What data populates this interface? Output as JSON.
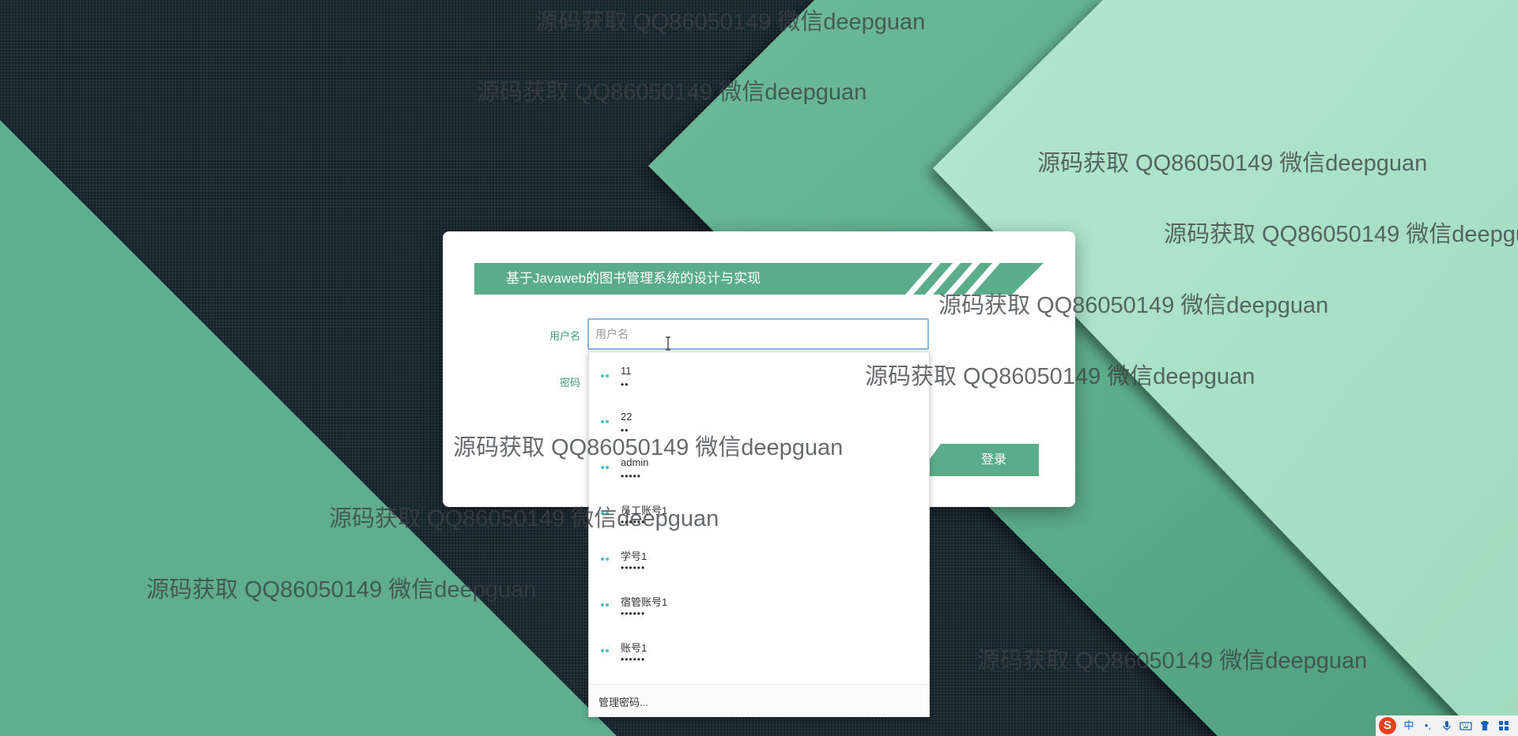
{
  "login": {
    "title": "基于Javaweb的图书管理系统的设计与实现",
    "username_label": "用户名",
    "username_placeholder": "用户名",
    "password_label": "密码",
    "login_button": "登录"
  },
  "autocomplete": {
    "items": [
      {
        "user": "11",
        "password": "••"
      },
      {
        "user": "22",
        "password": "••"
      },
      {
        "user": "admin",
        "password": "•••••"
      },
      {
        "user": "员工账号1",
        "password": "••••••"
      },
      {
        "user": "学号1",
        "password": "••••••"
      },
      {
        "user": "宿管账号1",
        "password": "••••••"
      },
      {
        "user": "账号1",
        "password": "••••••"
      }
    ],
    "manage_label": "管理密码..."
  },
  "watermark": {
    "text": "源码获取 QQ86050149 微信deepguan"
  },
  "ime_tray": {
    "logo": "S",
    "lang": "中",
    "punct": "•,",
    "icons": [
      "ime-logo-icon",
      "chinese-mode-icon",
      "punctuation-icon",
      "microphone-icon",
      "keyboard-icon",
      "skin-icon",
      "toolbox-icon"
    ]
  },
  "colors": {
    "accent_green": "#5aac8a",
    "dark_background": "#1b2a33",
    "light_green": "#a8e0c5",
    "mid_green": "#62b18f",
    "input_border": "#8db7e0"
  }
}
